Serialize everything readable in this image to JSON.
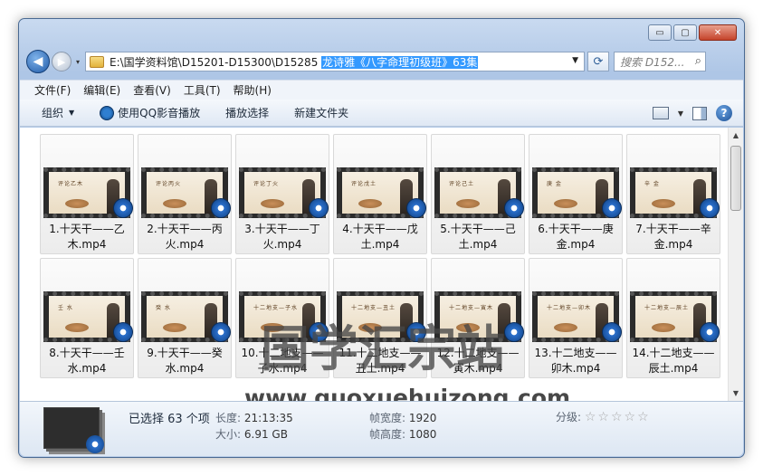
{
  "window": {
    "controls": {
      "minimize": "▭",
      "maximize": "▢",
      "close": "✕"
    }
  },
  "nav": {
    "back_glyph": "◀",
    "forward_glyph": "▶",
    "history_glyph": "▾",
    "address_path": "E:\\国学资料馆\\D15201-D15300\\D15285 ",
    "address_selected": "龙诗雅《八字命理初级班》63集",
    "address_drop_glyph": "▼",
    "refresh_glyph": "⟳",
    "search_placeholder": "搜索 D152...",
    "search_glyph": "⌕"
  },
  "menu": [
    "文件(F)",
    "编辑(E)",
    "查看(V)",
    "工具(T)",
    "帮助(H)"
  ],
  "toolbar": {
    "organize": "组织",
    "organize_caret": "▼",
    "play_qq": "使用QQ影音播放",
    "play_selection": "播放选择",
    "new_folder": "新建文件夹",
    "view_caret": "▼",
    "help_glyph": "?"
  },
  "files": [
    {
      "name": "1.十天干——乙木.mp4",
      "thumb": "评论乙木"
    },
    {
      "name": "2.十天干——丙火.mp4",
      "thumb": "评论丙火"
    },
    {
      "name": "3.十天干——丁火.mp4",
      "thumb": "评论丁火"
    },
    {
      "name": "4.十天干——戊土.mp4",
      "thumb": "评论戊土"
    },
    {
      "name": "5.十天干——己土.mp4",
      "thumb": "评论己土"
    },
    {
      "name": "6.十天干——庚金.mp4",
      "thumb": "庚 金"
    },
    {
      "name": "7.十天干——辛金.mp4",
      "thumb": "辛 金"
    },
    {
      "name": "8.十天干——壬水.mp4",
      "thumb": "壬 水"
    },
    {
      "name": "9.十天干——癸水.mp4",
      "thumb": "癸 水"
    },
    {
      "name": "10.十二地支——子水.mp4",
      "thumb": "十二地支—子水"
    },
    {
      "name": "11.十二地支——丑土.mp4",
      "thumb": "十二地支—丑土"
    },
    {
      "name": "12.十二地支——寅木.mp4",
      "thumb": "十二地支—寅木"
    },
    {
      "name": "13.十二地支——卯木.mp4",
      "thumb": "十二地支—卯木"
    },
    {
      "name": "14.十二地支——辰土.mp4",
      "thumb": "十二地支—辰土"
    }
  ],
  "watermark": {
    "text": "国学汇宗站",
    "url": "www.guoxuehuizong.com"
  },
  "details": {
    "selected": "已选择 63 个项",
    "length_label": "长度:",
    "length_value": "21:13:35",
    "size_label": "大小:",
    "size_value": "6.91 GB",
    "frame_width_label": "帧宽度:",
    "frame_width_value": "1920",
    "frame_height_label": "帧高度:",
    "frame_height_value": "1080",
    "rating_label": "分级:",
    "rating_stars": "☆☆☆☆☆",
    "rating_value": 0
  },
  "scrollbar": {
    "up_glyph": "▲",
    "down_glyph": "▼"
  }
}
